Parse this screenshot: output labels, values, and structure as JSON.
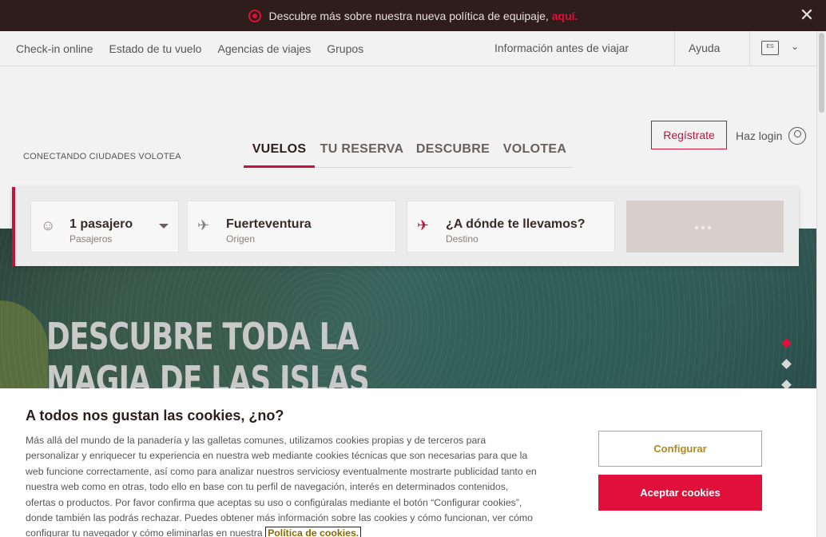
{
  "announcement": {
    "text": "Descubre más sobre nuestra nueva política de equipaje,",
    "link": "aquí.",
    "close_icon": "close-icon"
  },
  "topnav": {
    "items": [
      "Check-in online",
      "Estado de tu vuelo",
      "Agencias de viajes",
      "Grupos"
    ],
    "info": "Información antes de viajar",
    "help": "Ayuda",
    "lang": "ES"
  },
  "header": {
    "tagline": "CONECTANDO CIUDADES VOLOTEA",
    "tabs": [
      "VUELOS",
      "TU RESERVA",
      "DESCUBRE",
      "VOLOTEA"
    ],
    "register": "Regístrate",
    "login": "Haz login"
  },
  "search": {
    "passengers": {
      "value": "1 pasajero",
      "label": "Pasajeros"
    },
    "origin": {
      "value": "Fuerteventura",
      "label": "Origen"
    },
    "destination": {
      "value": "¿A dónde te llevamos?",
      "label": "Destino"
    }
  },
  "hero": {
    "title_line1": "DESCUBRE TODA LA",
    "title_line2": "MAGIA DE LAS ISLAS"
  },
  "cookie": {
    "title": "A todos nos gustan las cookies, ¿no?",
    "body": "Más allá del mundo de la panadería y las galletas comunes, utilizamos cookies propias y de terceros para personalizar y enriquecer tu experiencia en nuestra web mediante cookies técnicas que son necesarias para que la web funcione correctamente, así como para analizar nuestros serviciosy eventualmente mostrarte publicidad tanto en nuestra web como en otras, todo ello en base con tu perfil de navegación, interés en determinados contenidos, ofertas o productos. Por favor confirma que aceptas su uso o configúralas mediante el botón “Configurar cookies”, donde también las podrás rechazar. Puedes obtener más información sobre las cookies y cómo funcionan, ver cómo configurar tu navegador y cómo eliminarlas en nuestra",
    "policy_link": "Política de cookies.",
    "configure": "Configurar",
    "accept": "Aceptar cookies"
  },
  "colors": {
    "brand_red": "#e0103a",
    "dark_brown": "#2e1d1b",
    "gold": "#b28a1e"
  }
}
